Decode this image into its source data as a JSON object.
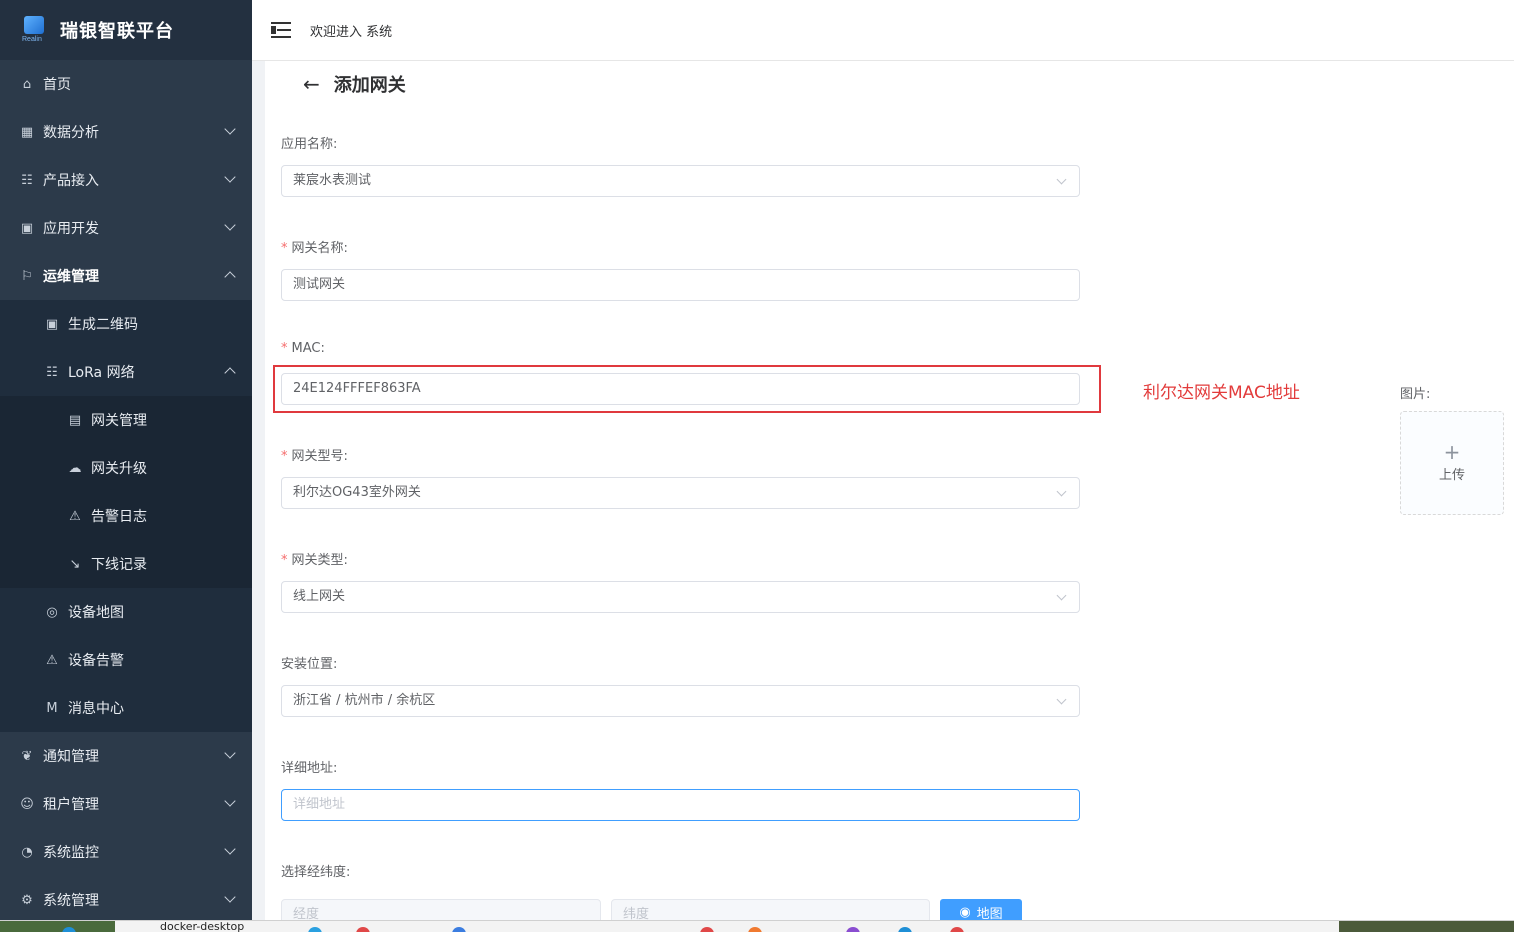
{
  "app": {
    "brand": "瑞银智联平台",
    "logo_subtext": "Realin"
  },
  "header": {
    "welcome": "欢迎进入 系统"
  },
  "sidebar": {
    "items": [
      {
        "label": "首页",
        "icon": "home-icon",
        "level": 1,
        "arrow": "none"
      },
      {
        "label": "数据分析",
        "icon": "chart-icon",
        "level": 1,
        "arrow": "down"
      },
      {
        "label": "产品接入",
        "icon": "network-icon",
        "level": 1,
        "arrow": "down"
      },
      {
        "label": "应用开发",
        "icon": "grid-icon",
        "level": 1,
        "arrow": "down"
      },
      {
        "label": "运维管理",
        "icon": "bell-icon",
        "level": 1,
        "arrow": "up"
      },
      {
        "label": "生成二维码",
        "icon": "qrcode-icon",
        "level": 2,
        "arrow": "none"
      },
      {
        "label": "LoRa 网络",
        "icon": "network-icon",
        "level": 2,
        "arrow": "up"
      },
      {
        "label": "网关管理",
        "icon": "table-icon",
        "level": 3,
        "arrow": "none"
      },
      {
        "label": "网关升级",
        "icon": "cloud-upload-icon",
        "level": 3,
        "arrow": "none"
      },
      {
        "label": "告警日志",
        "icon": "warning-icon",
        "level": 3,
        "arrow": "none"
      },
      {
        "label": "下线记录",
        "icon": "trend-down-icon",
        "level": 3,
        "arrow": "none"
      },
      {
        "label": "设备地图",
        "icon": "location-icon",
        "level": 2,
        "arrow": "none"
      },
      {
        "label": "设备告警",
        "icon": "warning-icon",
        "level": 2,
        "arrow": "none"
      },
      {
        "label": "消息中心",
        "icon": "message-icon",
        "level": 2,
        "arrow": "none"
      },
      {
        "label": "通知管理",
        "icon": "link-icon",
        "level": 1,
        "arrow": "down"
      },
      {
        "label": "租户管理",
        "icon": "user-icon",
        "level": 1,
        "arrow": "down"
      },
      {
        "label": "系统监控",
        "icon": "monitor-icon",
        "level": 1,
        "arrow": "down"
      },
      {
        "label": "系统管理",
        "icon": "gear-icon",
        "level": 1,
        "arrow": "down"
      }
    ]
  },
  "page": {
    "title": "添加网关",
    "app_name": {
      "label": "应用名称:",
      "value": "莱宸水表测试"
    },
    "gateway_name": {
      "label": "网关名称:",
      "value": "测试网关"
    },
    "mac": {
      "label": "MAC:",
      "value": "24E124FFFEF863FA"
    },
    "gateway_model": {
      "label": "网关型号:",
      "value": "利尔达OG43室外网关"
    },
    "gateway_type": {
      "label": "网关类型:",
      "value": "线上网关"
    },
    "location": {
      "label": "安装位置:",
      "value": "浙江省 / 杭州市 / 余杭区"
    },
    "address": {
      "label": "详细地址:",
      "placeholder": "详细地址"
    },
    "coords": {
      "label": "选择经纬度:",
      "lng_placeholder": "经度",
      "lat_placeholder": "纬度",
      "map_button": "地图"
    },
    "image": {
      "label": "图片:",
      "upload_text": "上传",
      "plus": "+"
    },
    "annotation": "利尔达网关MAC地址"
  },
  "taskbar": {
    "text": "docker-desktop"
  }
}
